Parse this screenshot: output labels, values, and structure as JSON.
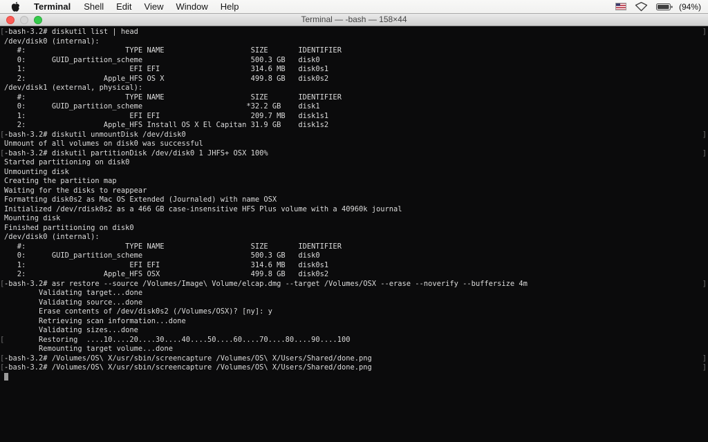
{
  "menubar": {
    "menus": [
      "Terminal",
      "Shell",
      "Edit",
      "View",
      "Window",
      "Help"
    ],
    "battery": "(94%)",
    "icons": [
      "apple-logo",
      "us-flag-icon",
      "wifi-diamond-icon",
      "battery-icon"
    ]
  },
  "window": {
    "title": "Terminal — -bash — 158×44"
  },
  "colors": {
    "terminal_bg": "#0b0b0c",
    "terminal_fg": "#dcdcdc",
    "mark": "#6f6f6f",
    "cursor": "#9a9a9a",
    "menubar_bg": "#f6f6f5",
    "traffic_red": "#fb5d57",
    "traffic_gray": "#d5d5d5",
    "traffic_green": "#35cb4b"
  },
  "terminal": {
    "prompt": "-bash-3.2#",
    "lines": [
      {
        "t": "-bash-3.2# diskutil list | head",
        "m": "lr"
      },
      {
        "t": "/dev/disk0 (internal):"
      },
      {
        "t": "   #:                       TYPE NAME                    SIZE       IDENTIFIER"
      },
      {
        "t": "   0:      GUID_partition_scheme                         500.3 GB   disk0"
      },
      {
        "t": "   1:                        EFI EFI                     314.6 MB   disk0s1"
      },
      {
        "t": "   2:                  Apple_HFS OS X                    499.8 GB   disk0s2"
      },
      {
        "t": "/dev/disk1 (external, physical):"
      },
      {
        "t": "   #:                       TYPE NAME                    SIZE       IDENTIFIER"
      },
      {
        "t": "   0:      GUID_partition_scheme                        *32.2 GB    disk1"
      },
      {
        "t": "   1:                        EFI EFI                     209.7 MB   disk1s1"
      },
      {
        "t": "   2:                  Apple_HFS Install OS X El Capitan 31.9 GB    disk1s2"
      },
      {
        "t": "-bash-3.2# diskutil unmountDisk /dev/disk0",
        "m": "lr"
      },
      {
        "t": "Unmount of all volumes on disk0 was successful"
      },
      {
        "t": "-bash-3.2# diskutil partitionDisk /dev/disk0 1 JHFS+ OSX 100%",
        "m": "lr"
      },
      {
        "t": "Started partitioning on disk0"
      },
      {
        "t": "Unmounting disk"
      },
      {
        "t": "Creating the partition map"
      },
      {
        "t": "Waiting for the disks to reappear"
      },
      {
        "t": "Formatting disk0s2 as Mac OS Extended (Journaled) with name OSX"
      },
      {
        "t": "Initialized /dev/rdisk0s2 as a 466 GB case-insensitive HFS Plus volume with a 40960k journal"
      },
      {
        "t": "Mounting disk"
      },
      {
        "t": "Finished partitioning on disk0"
      },
      {
        "t": "/dev/disk0 (internal):"
      },
      {
        "t": "   #:                       TYPE NAME                    SIZE       IDENTIFIER"
      },
      {
        "t": "   0:      GUID_partition_scheme                         500.3 GB   disk0"
      },
      {
        "t": "   1:                        EFI EFI                     314.6 MB   disk0s1"
      },
      {
        "t": "   2:                  Apple_HFS OSX                     499.8 GB   disk0s2"
      },
      {
        "t": "-bash-3.2# asr restore --source /Volumes/Image\\ Volume/elcap.dmg --target /Volumes/OSX --erase --noverify --buffersize 4m",
        "m": "lr"
      },
      {
        "t": "        Validating target...done"
      },
      {
        "t": "        Validating source...done"
      },
      {
        "t": "        Erase contents of /dev/disk0s2 (/Volumes/OSX)? [ny]: y"
      },
      {
        "t": "        Retrieving scan information...done"
      },
      {
        "t": "        Validating sizes...done"
      },
      {
        "t": "        Restoring  ....10....20....30....40....50....60....70....80....90....100",
        "m": "l"
      },
      {
        "t": "        Remounting target volume...done"
      },
      {
        "t": "-bash-3.2# /Volumes/OS\\ X/usr/sbin/screencapture /Volumes/OS\\ X/Users/Shared/done.png",
        "m": "lr"
      },
      {
        "t": "-bash-3.2# /Volumes/OS\\ X/usr/sbin/screencapture /Volumes/OS\\ X/Users/Shared/done.png",
        "m": "lr"
      },
      {
        "t": "",
        "c": true
      }
    ]
  }
}
